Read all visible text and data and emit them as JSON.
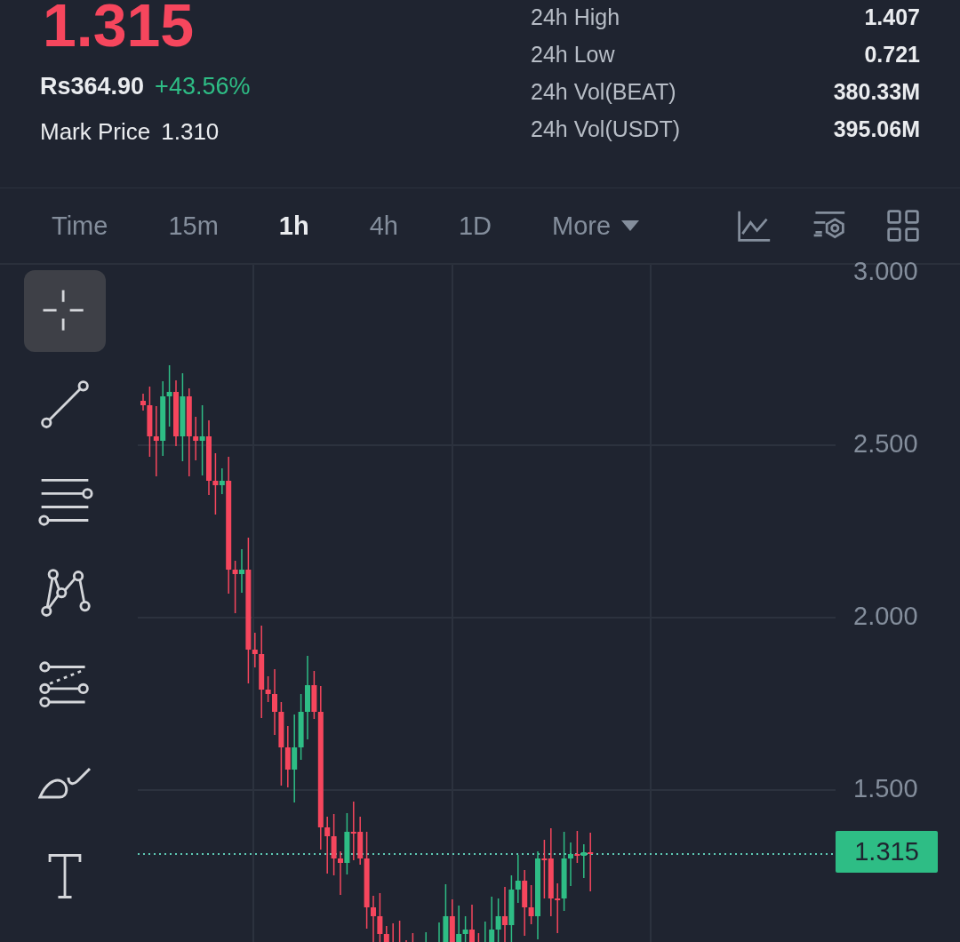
{
  "ticker": {
    "last_price": "1.315",
    "fiat_price": "Rs364.90",
    "change": "+43.56%",
    "mark_label": "Mark Price",
    "mark_value": "1.310"
  },
  "stats": [
    {
      "label": "24h High",
      "value": "1.407"
    },
    {
      "label": "24h Low",
      "value": "0.721"
    },
    {
      "label": "24h Vol(BEAT)",
      "value": "380.33M"
    },
    {
      "label": "24h Vol(USDT)",
      "value": "395.06M"
    }
  ],
  "intervals": [
    {
      "label": "Time",
      "selected": false
    },
    {
      "label": "15m",
      "selected": false
    },
    {
      "label": "1h",
      "selected": true
    },
    {
      "label": "4h",
      "selected": false
    },
    {
      "label": "1D",
      "selected": false
    },
    {
      "label": "More",
      "selected": false,
      "kind": "dropdown"
    }
  ],
  "chart_tools": [
    {
      "kind": "chart-type"
    },
    {
      "kind": "indicators"
    },
    {
      "kind": "layout"
    }
  ],
  "drawing_tools": [
    {
      "kind": "crosshair",
      "selected": true
    },
    {
      "kind": "trend-line",
      "selected": false
    },
    {
      "kind": "horizontal-lines",
      "selected": false
    },
    {
      "kind": "pattern",
      "selected": false
    },
    {
      "kind": "parallel-channel",
      "selected": false
    },
    {
      "kind": "brush",
      "selected": false
    },
    {
      "kind": "text",
      "selected": false
    }
  ],
  "price_axis": [
    "3.000",
    "2.500",
    "2.000",
    "1.500"
  ],
  "current_price_tag": "1.315"
}
